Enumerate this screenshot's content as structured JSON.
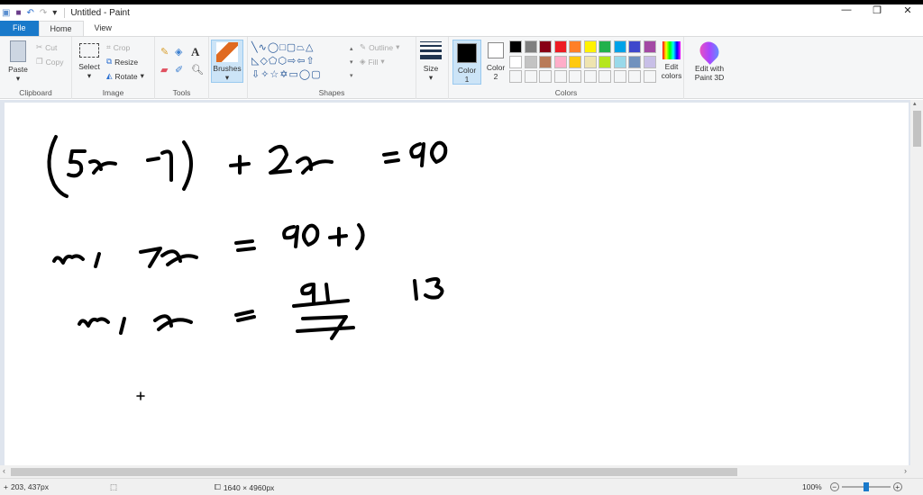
{
  "window": {
    "title": "Untitled - Paint",
    "minimize": "—",
    "maximize": "❐",
    "close": "✕"
  },
  "tabs": [
    {
      "label": "File"
    },
    {
      "label": "Home"
    },
    {
      "label": "View"
    }
  ],
  "clipboard": {
    "paste": "Paste",
    "cut": "Cut",
    "copy": "Copy",
    "label": "Clipboard"
  },
  "image": {
    "select": "Select",
    "crop": "Crop",
    "resize": "Resize",
    "rotate": "Rotate",
    "label": "Image"
  },
  "tools": {
    "label": "Tools"
  },
  "brushes": {
    "label": "Brushes"
  },
  "shapes": {
    "outline": "Outline",
    "fill": "Fill",
    "label": "Shapes"
  },
  "size": {
    "label": "Size"
  },
  "colors": {
    "color1": "Color",
    "color1_num": "1",
    "color2": "Color",
    "color2_num": "2",
    "edit1": "Edit",
    "edit2": "colors",
    "label": "Colors",
    "palette_row1": [
      "#000000",
      "#7f7f7f",
      "#880015",
      "#ed1c24",
      "#ff7f27",
      "#fff200",
      "#22b14c",
      "#00a2e8",
      "#3f48cc",
      "#a349a4"
    ],
    "palette_row2": [
      "#ffffff",
      "#c3c3c3",
      "#b97a57",
      "#ffaec9",
      "#ffc90e",
      "#efe4b0",
      "#b5e61d",
      "#99d9ea",
      "#7092be",
      "#c8bfe7"
    ]
  },
  "paint3d": {
    "line1": "Edit with",
    "line2": "Paint 3D"
  },
  "status": {
    "cursor": "203, 437px",
    "canvas_size": "1640 × 4960px",
    "zoom": "100%",
    "zoom_level": 100
  },
  "accent": "#1979ca"
}
